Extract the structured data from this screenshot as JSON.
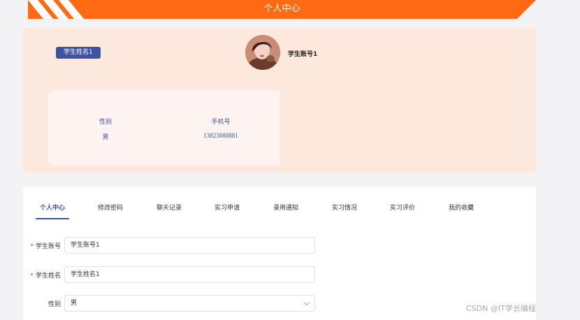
{
  "header": {
    "title": "个人中心"
  },
  "profile": {
    "name_tag": "学生姓名1",
    "account_name": "学生账号1",
    "info": [
      {
        "label": "性别",
        "value": "男"
      },
      {
        "label": "手机号",
        "value": "13823888881"
      }
    ]
  },
  "tabs": [
    {
      "label": "个人中心",
      "active": true
    },
    {
      "label": "修改密码"
    },
    {
      "label": "聊天记录"
    },
    {
      "label": "实习申请"
    },
    {
      "label": "录用通知"
    },
    {
      "label": "实习情况"
    },
    {
      "label": "实习评价"
    },
    {
      "label": "我的收藏"
    }
  ],
  "form": {
    "account": {
      "required_mark": "*",
      "label": "学生账号",
      "value": "学生账号1"
    },
    "name": {
      "required_mark": "*",
      "label": "学生姓名",
      "value": "学生姓名1"
    },
    "gender": {
      "label": "性别",
      "value": "男"
    }
  },
  "watermark": "CSDN @IT学长编程",
  "colors": {
    "accent": "#3d52a0",
    "banner": "#ff6a13",
    "card_bg": "#fce8dc"
  }
}
